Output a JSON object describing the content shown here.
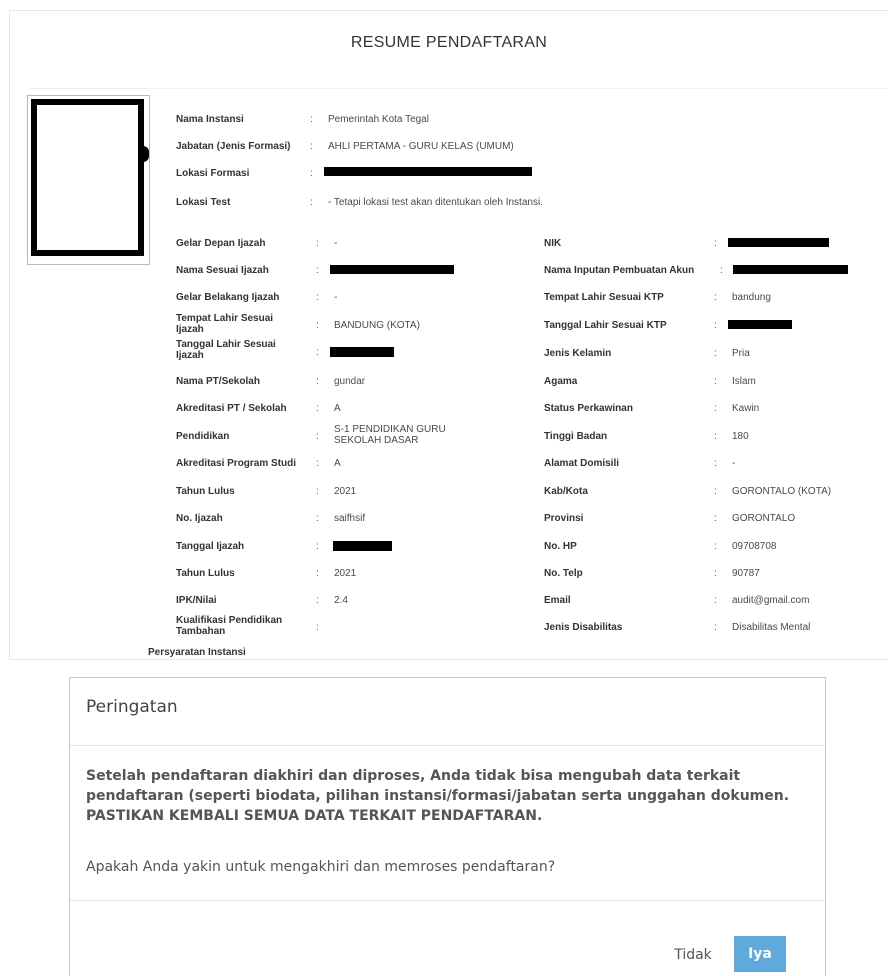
{
  "resume": {
    "title": "RESUME PENDAFTARAN",
    "top_fields": [
      {
        "label": "Nama Instansi",
        "value": "Pemerintah Kota Tegal"
      },
      {
        "label": "Jabatan (Jenis Formasi)",
        "value": "AHLI PERTAMA - GURU KELAS (UMUM)"
      },
      {
        "label": "Lokasi Formasi",
        "value": ""
      },
      {
        "label": "Lokasi Test",
        "value": "- Tetapi lokasi test akan ditentukan oleh Instansi."
      }
    ],
    "left_fields": [
      {
        "label": "Gelar Depan Ijazah",
        "value": "-"
      },
      {
        "label": "Nama Sesuai Ijazah",
        "value": ""
      },
      {
        "label": "Gelar Belakang Ijazah",
        "value": "-"
      },
      {
        "label": "Tempat Lahir Sesuai Ijazah",
        "value": "BANDUNG (KOTA)"
      },
      {
        "label": "Tanggal Lahir Sesuai Ijazah",
        "value": ""
      },
      {
        "label": "Nama PT/Sekolah",
        "value": "gundar"
      },
      {
        "label": "Akreditasi PT / Sekolah",
        "value": "A"
      },
      {
        "label": "Pendidikan",
        "value": "S-1 PENDIDIKAN GURU SEKOLAH DASAR"
      },
      {
        "label": "Akreditasi Program Studi",
        "value": "A"
      },
      {
        "label": "Tahun Lulus",
        "value": "2021"
      },
      {
        "label": "No. Ijazah",
        "value": "saifhsif"
      },
      {
        "label": "Tanggal Ijazah",
        "value": ""
      },
      {
        "label": "Tahun Lulus",
        "value": "2021"
      },
      {
        "label": "IPK/Nilai",
        "value": "2.4"
      },
      {
        "label": "Kualifikasi Pendidikan Tambahan",
        "value": ""
      }
    ],
    "right_fields": [
      {
        "label": "NIK",
        "value": ""
      },
      {
        "label": "Nama Inputan Pembuatan Akun",
        "value": ""
      },
      {
        "label": "Tempat Lahir Sesuai KTP",
        "value": "bandung"
      },
      {
        "label": "Tanggal Lahir Sesuai KTP",
        "value": ""
      },
      {
        "label": "Jenis Kelamin",
        "value": "Pria"
      },
      {
        "label": "Agama",
        "value": "Islam"
      },
      {
        "label": "Status Perkawinan",
        "value": "Kawin"
      },
      {
        "label": "Tinggi Badan",
        "value": "180"
      },
      {
        "label": "Alamat Domisili",
        "value": "-"
      },
      {
        "label": "Kab/Kota",
        "value": "GORONTALO (KOTA)"
      },
      {
        "label": "Provinsi",
        "value": "GORONTALO"
      },
      {
        "label": "No. HP",
        "value": "09708708"
      },
      {
        "label": "No. Telp",
        "value": "90787"
      },
      {
        "label": "Email",
        "value": "audit@gmail.com"
      },
      {
        "label": "Jenis Disabilitas",
        "value": "Disabilitas Mental"
      }
    ],
    "persyaratan_label": "Persyaratan Instansi",
    "colon": ":"
  },
  "modal": {
    "title": "Peringatan",
    "message": "Setelah pendaftaran diakhiri dan diproses, Anda tidak bisa mengubah data terkait pendaftaran (seperti biodata, pilihan instansi/formasi/jabatan serta unggahan dokumen. PASTIKAN KEMBALI SEMUA DATA TERKAIT PENDAFTARAN.",
    "question": "Apakah Anda yakin untuk mengakhiri dan memroses pendaftaran?",
    "cancel_label": "Tidak",
    "confirm_label": "Iya",
    "confirm_color": "#5fa9dc"
  }
}
